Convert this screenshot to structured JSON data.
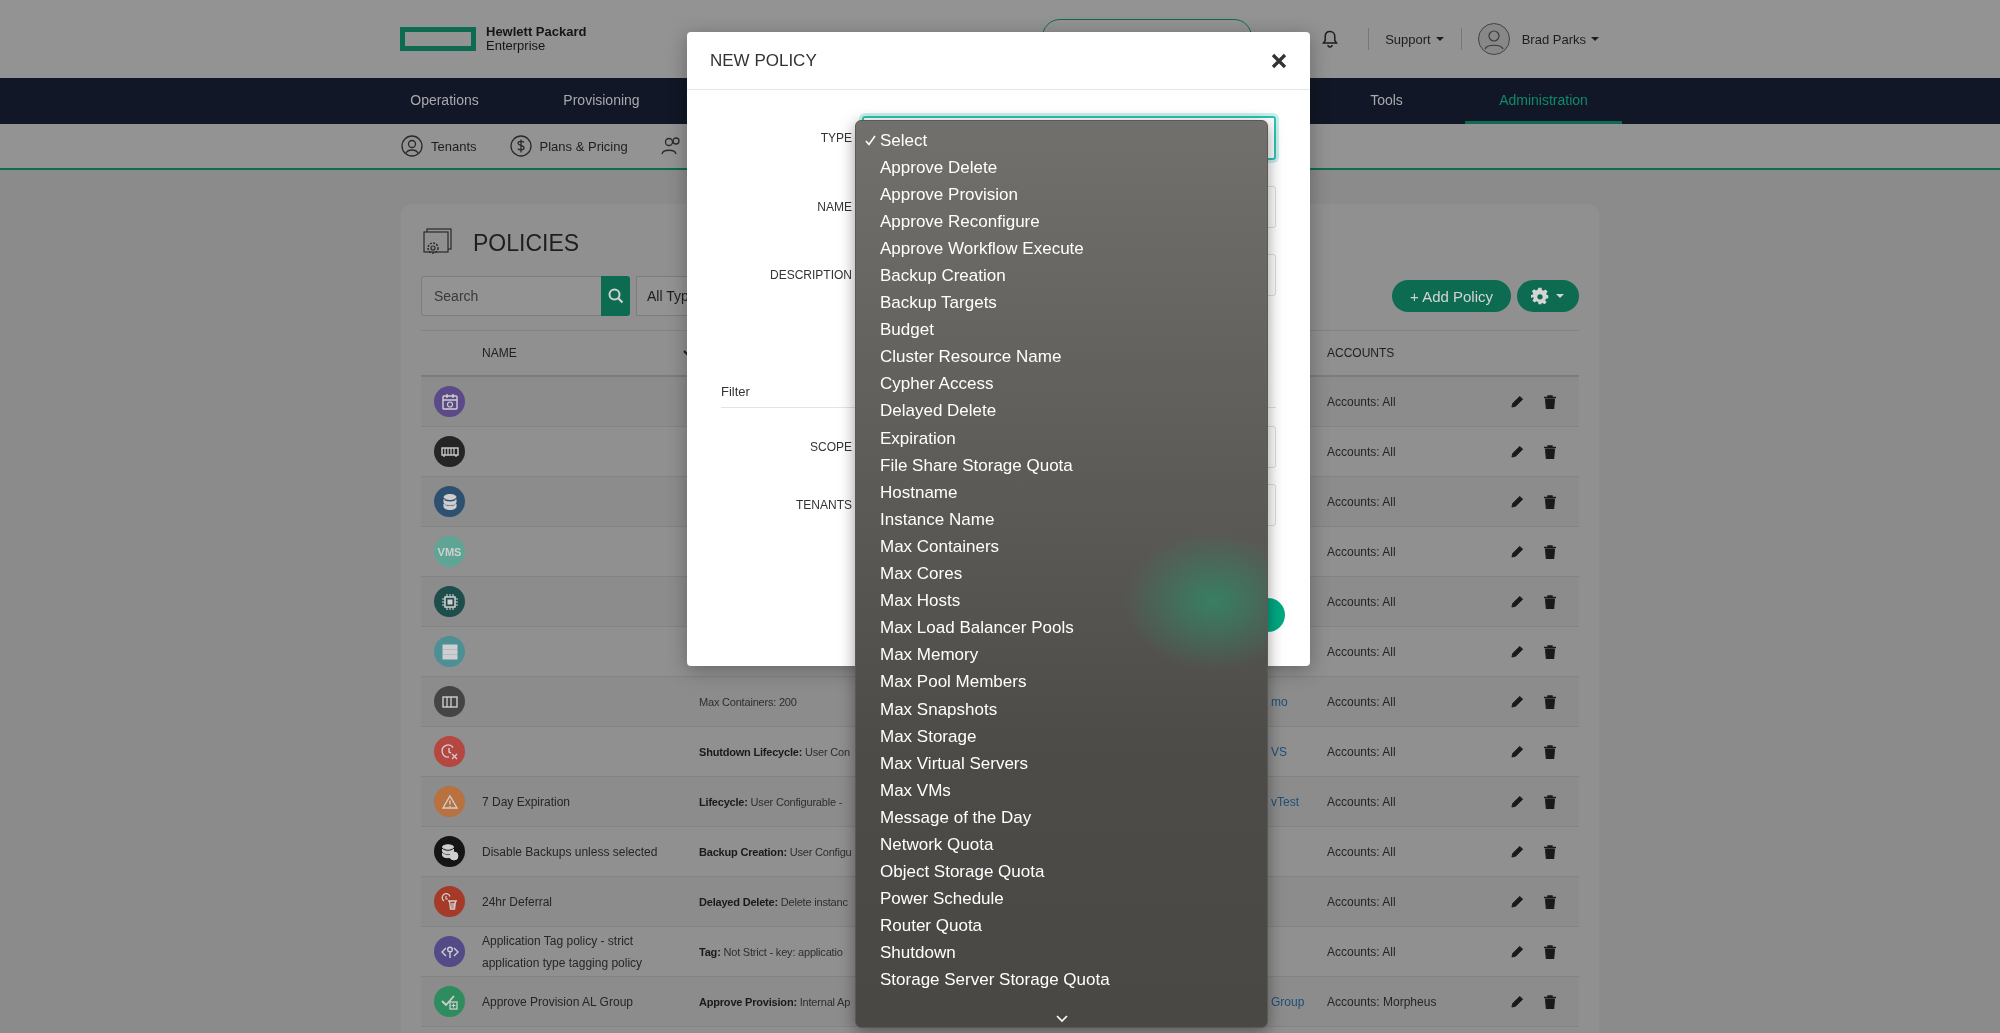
{
  "header": {
    "logo_lines": [
      "Hewlett Packard",
      "Enterprise"
    ],
    "support": "Support",
    "user": "Brad Parks"
  },
  "nav": [
    {
      "label": "Operations",
      "selected": false
    },
    {
      "label": "Provisioning",
      "selected": false
    },
    {
      "label": "Tools",
      "selected": false
    },
    {
      "label": "Administration",
      "selected": true
    }
  ],
  "subnav": [
    {
      "kind": "link",
      "label": "Tenants"
    },
    {
      "kind": "link",
      "label": "Plans & Pricing"
    },
    {
      "kind": "icon_only"
    }
  ],
  "policies": {
    "title": "POLICIES",
    "search": {
      "placeholder": "Search"
    },
    "type_filter": {
      "value": "All Typ"
    },
    "add_button": "+ Add Policy",
    "columns": [
      {
        "label": "NAME",
        "sorted": true
      },
      {
        "label": "ACCOUNTS",
        "sorted": false
      }
    ],
    "rows": [
      {
        "color": "#5b4a87",
        "accounts": "Accounts: All"
      },
      {
        "color": "#252525",
        "accounts": "Accounts: All"
      },
      {
        "color": "#2d4f70",
        "accounts": "Accounts: All"
      },
      {
        "icon_text": "VMS",
        "color": "#5fa596",
        "accounts": "Accounts: All"
      },
      {
        "color": "#1d4e4b",
        "accounts": "Accounts: All"
      },
      {
        "color": "#4c8f94",
        "accounts": "Accounts: All"
      },
      {
        "color": "#444444",
        "description": "Max Containers: 200",
        "column_4": "mo",
        "accounts": "Accounts: All"
      },
      {
        "color": "#b54640",
        "description": "**Shutdown Lifecycle:** User Con",
        "column_4": "VS",
        "accounts": "Accounts: All"
      },
      {
        "color": "#b8713f",
        "name": "7 Day Expiration",
        "description": "**Lifecycle:** User Configurable -",
        "column_4": "vTest",
        "accounts": "Accounts: All"
      },
      {
        "color": "#151515",
        "name": "Disable Backups unless selected",
        "description": "**Backup Creation:** User Configu",
        "accounts": "Accounts: All"
      },
      {
        "color": "#a53a28",
        "name": "24hr Deferral",
        "description": "**Delayed Delete:** Delete instanc",
        "accounts": "Accounts: All"
      },
      {
        "color": "#534a88",
        "name": "Application Tag policy - strict application type tagging policy",
        "description": "**Tag:** Not Strict - key: applicatio",
        "accounts": "Accounts: All"
      },
      {
        "color": "#2f8c5e",
        "name": "Approve Provision AL Group",
        "description": "**Approve Provision:** Internal Ap",
        "column_4": "Group",
        "accounts": "Accounts: Morpheus"
      }
    ]
  },
  "modal": {
    "title": "NEW POLICY",
    "fields": [
      {
        "label": "TYPE",
        "kind": "select",
        "focused": true
      },
      {
        "label": "NAME",
        "kind": "text",
        "focused": false
      },
      {
        "label": "DESCRIPTION",
        "kind": "text",
        "focused": false
      },
      {
        "label": "Filter",
        "kind": "filter"
      },
      {
        "label": "SCOPE",
        "kind": "select",
        "focused": false
      },
      {
        "label": "TENANTS",
        "kind": "select",
        "focused": false
      }
    ]
  },
  "dropdown": {
    "options": [
      {
        "label": "Select",
        "selected": true
      },
      {
        "label": "Approve Delete",
        "selected": false
      },
      {
        "label": "Approve Provision",
        "selected": false
      },
      {
        "label": "Approve Reconfigure",
        "selected": false
      },
      {
        "label": "Approve Workflow Execute",
        "selected": false
      },
      {
        "label": "Backup Creation",
        "selected": false
      },
      {
        "label": "Backup Targets",
        "selected": false
      },
      {
        "label": "Budget",
        "selected": false
      },
      {
        "label": "Cluster Resource Name",
        "selected": false
      },
      {
        "label": "Cypher Access",
        "selected": false
      },
      {
        "label": "Delayed Delete",
        "selected": false
      },
      {
        "label": "Expiration",
        "selected": false
      },
      {
        "label": "File Share Storage Quota",
        "selected": false
      },
      {
        "label": "Hostname",
        "selected": false
      },
      {
        "label": "Instance Name",
        "selected": false
      },
      {
        "label": "Max Containers",
        "selected": false
      },
      {
        "label": "Max Cores",
        "selected": false
      },
      {
        "label": "Max Hosts",
        "selected": false
      },
      {
        "label": "Max Load Balancer Pools",
        "selected": false
      },
      {
        "label": "Max Memory",
        "selected": false
      },
      {
        "label": "Max Pool Members",
        "selected": false
      },
      {
        "label": "Max Snapshots",
        "selected": false
      },
      {
        "label": "Max Storage",
        "selected": false
      },
      {
        "label": "Max Virtual Servers",
        "selected": false
      },
      {
        "label": "Max VMs",
        "selected": false
      },
      {
        "label": "Message of the Day",
        "selected": false
      },
      {
        "label": "Network Quota",
        "selected": false
      },
      {
        "label": "Object Storage Quota",
        "selected": false
      },
      {
        "label": "Power Schedule",
        "selected": false
      },
      {
        "label": "Router Quota",
        "selected": false
      },
      {
        "label": "Shutdown",
        "selected": false
      },
      {
        "label": "Storage Server Storage Quota",
        "selected": false
      }
    ]
  }
}
